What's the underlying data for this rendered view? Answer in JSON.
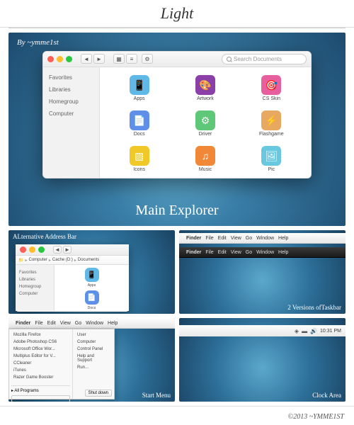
{
  "header": {
    "title": "Light"
  },
  "main": {
    "by": "By ~ymme1st",
    "caption": "Main Explorer",
    "window": {
      "search_placeholder": "Search Documents",
      "sidebar": [
        "Favorites",
        "Libraries",
        "Homegroup",
        "Computer"
      ],
      "files": [
        {
          "name": "Apps",
          "icon": "📱",
          "bg": "#5fb8e8"
        },
        {
          "name": "Artwork",
          "icon": "🎨",
          "bg": "#8b3fa8"
        },
        {
          "name": "CS Skin",
          "icon": "🎯",
          "bg": "#e85f9f"
        },
        {
          "name": "Docs",
          "icon": "📄",
          "bg": "#5f8fe8"
        },
        {
          "name": "Driver",
          "icon": "⚙",
          "bg": "#5fc878"
        },
        {
          "name": "Flashgame",
          "icon": "⚡",
          "bg": "#e8a85f"
        },
        {
          "name": "Icons",
          "icon": "▧",
          "bg": "#f0c828"
        },
        {
          "name": "Music",
          "icon": "♫",
          "bg": "#f08838"
        },
        {
          "name": "Pic",
          "icon": "🖼",
          "bg": "#68c8e0"
        }
      ]
    }
  },
  "addr": {
    "caption": "ALternative Address Bar",
    "crumbs": [
      "Computer",
      "Cache (D:)",
      "Documents"
    ],
    "sidebar": [
      "Favorites",
      "Libraries",
      "Homegroup",
      "Computer"
    ],
    "files": [
      {
        "name": "Apps",
        "icon": "📱",
        "bg": "#5fb8e8"
      },
      {
        "name": "Docs",
        "icon": "📄",
        "bg": "#5f8fe8"
      }
    ]
  },
  "taskbar": {
    "caption": "2 Versions ofTaskbar",
    "light": [
      "Finder",
      "File",
      "Edit",
      "View",
      "Go",
      "Window",
      "Help"
    ],
    "dark": [
      "Finder",
      "File",
      "Edit",
      "View",
      "Go",
      "Window",
      "Help"
    ]
  },
  "startmenu": {
    "caption": "Start Menu",
    "menubar": [
      "Finder",
      "File",
      "Edit",
      "View",
      "Go",
      "Window",
      "Help"
    ],
    "left": [
      "Mozilla Firefox",
      "Adobe Photoshop CS6",
      "Microsoft Office Wor...",
      "Multiplus Editor for V...",
      "CCleaner",
      "iTunes",
      "Razer Game Booster"
    ],
    "all_programs": "All Programs",
    "right": [
      "User",
      "Computer",
      "Control Panel",
      "Help and Support",
      "Run..."
    ],
    "shutdown": "Shut down"
  },
  "clock": {
    "caption": "Clock Area",
    "time": "10:31 PM"
  },
  "footer": "©2013 ~YMME1ST"
}
